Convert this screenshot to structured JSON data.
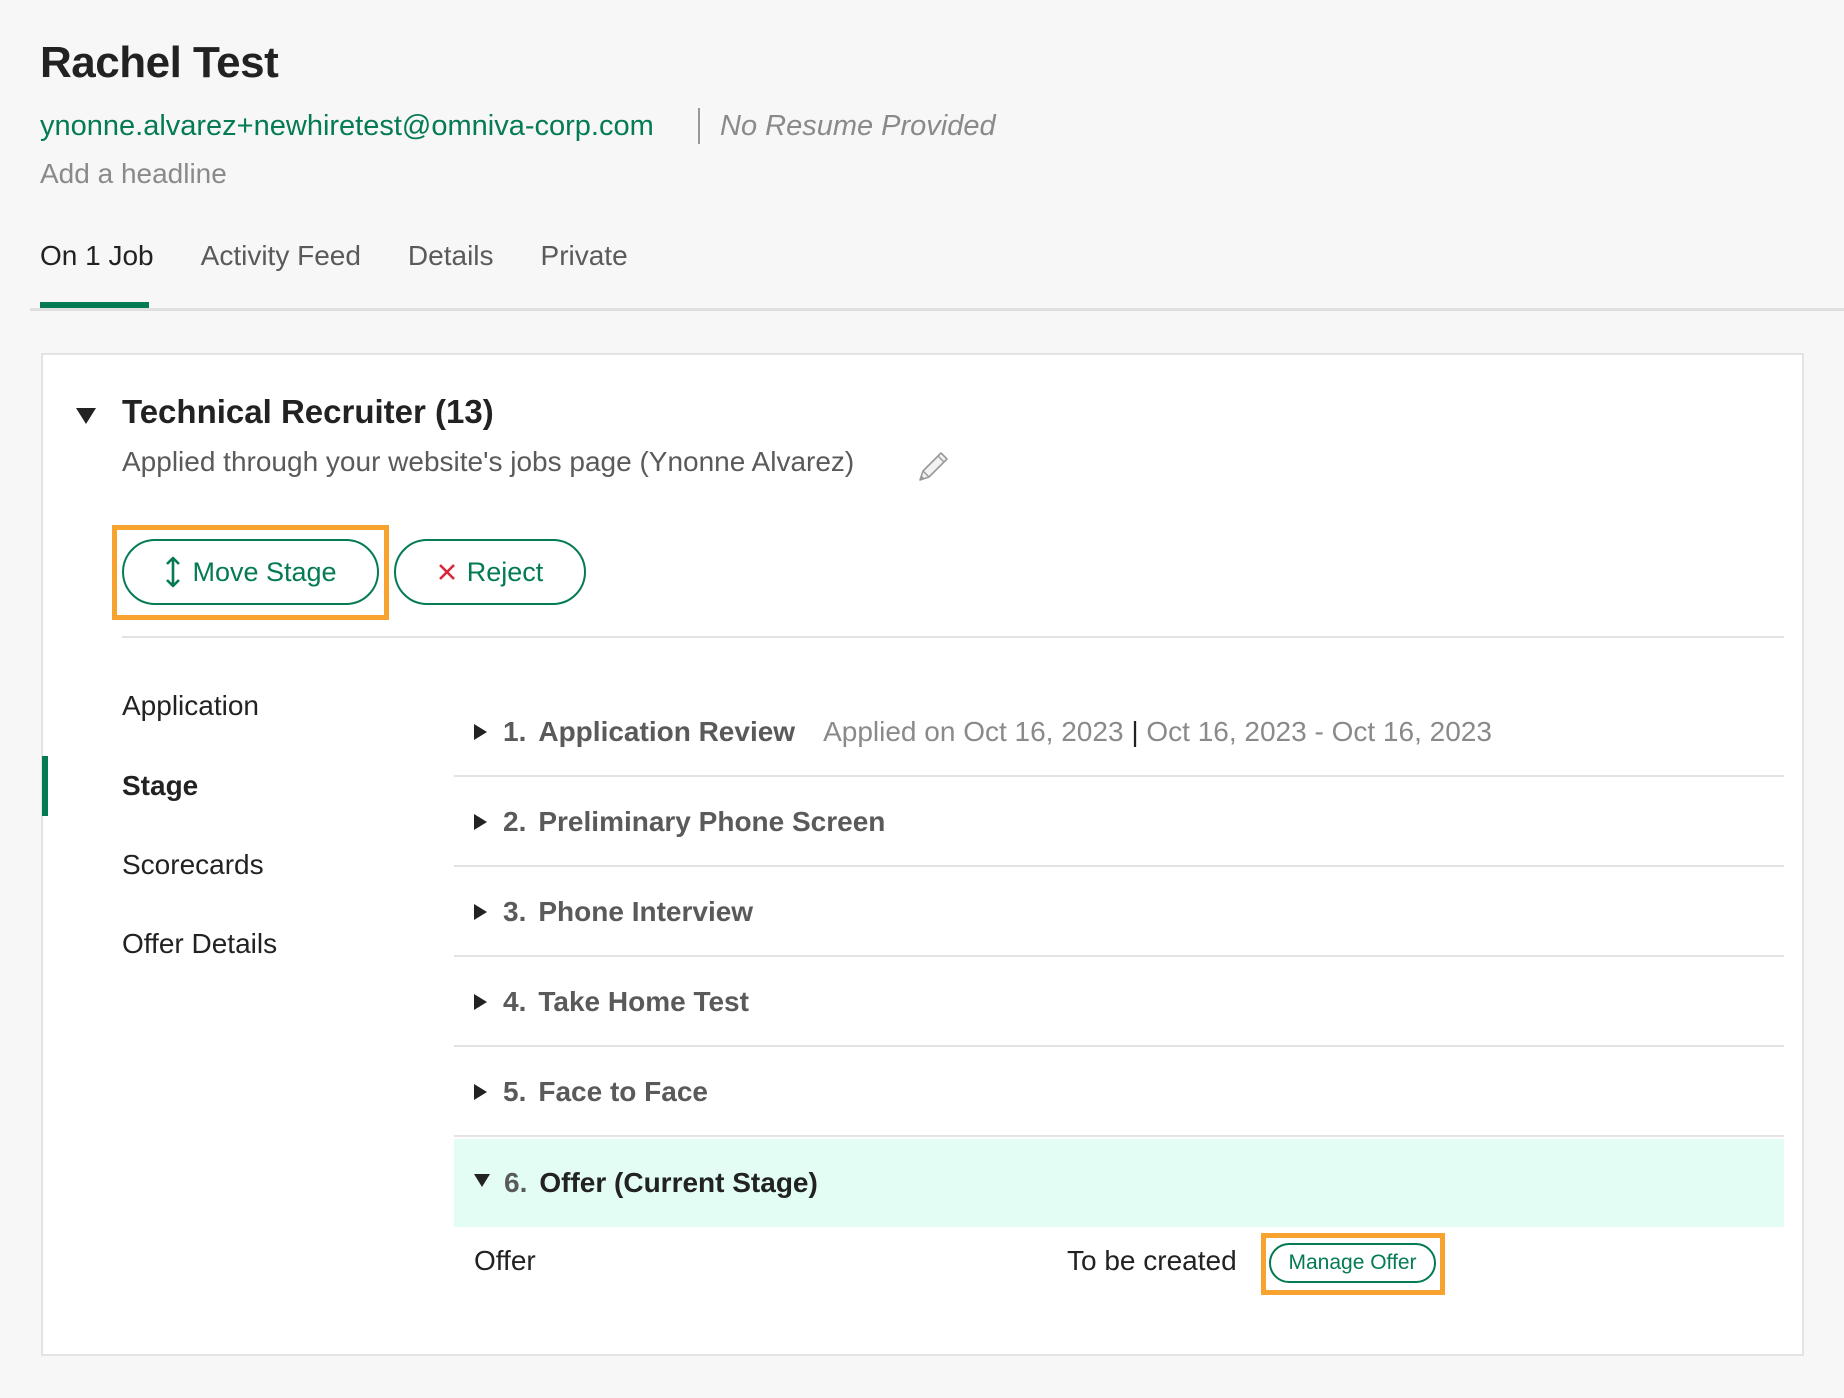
{
  "candidate": {
    "name": "Rachel Test",
    "email": "ynonne.alvarez+newhiretest@omniva-corp.com",
    "resume_status": "No Resume Provided",
    "headline_placeholder": "Add a headline"
  },
  "tabs": [
    {
      "label": "On 1 Job",
      "active": true
    },
    {
      "label": "Activity Feed",
      "active": false
    },
    {
      "label": "Details",
      "active": false
    },
    {
      "label": "Private",
      "active": false
    }
  ],
  "job": {
    "title": "Technical Recruiter (13)",
    "source": "Applied through your website's jobs page (Ynonne Alvarez)",
    "edit_icon": "pencil-icon",
    "expand_icon": "caret-down-icon"
  },
  "actions": {
    "move_stage_label": "Move Stage",
    "move_stage_icon": "vertical-arrows-icon",
    "reject_label": "Reject",
    "reject_icon": "x-icon"
  },
  "section_nav": [
    {
      "label": "Application",
      "active": false
    },
    {
      "label": "Stage",
      "active": true
    },
    {
      "label": "Scorecards",
      "active": false
    },
    {
      "label": "Offer Details",
      "active": false
    }
  ],
  "stages": [
    {
      "number": "1.",
      "name": "Application Review",
      "meta_applied": "Applied on Oct 16, 2023",
      "meta_sep": "|",
      "meta_range": "Oct 16, 2023 - Oct 16, 2023",
      "expanded": false
    },
    {
      "number": "2.",
      "name": "Preliminary Phone Screen",
      "expanded": false
    },
    {
      "number": "3.",
      "name": "Phone Interview",
      "expanded": false
    },
    {
      "number": "4.",
      "name": "Take Home Test",
      "expanded": false
    },
    {
      "number": "5.",
      "name": "Face to Face",
      "expanded": false
    },
    {
      "number": "6.",
      "name": "Offer (Current Stage)",
      "expanded": true,
      "current": true
    }
  ],
  "offer": {
    "label": "Offer",
    "status": "To be created",
    "manage_label": "Manage Offer"
  },
  "colors": {
    "brand_green": "#047a55",
    "highlight_orange": "#f8a330",
    "current_stage_bg": "#e3fdf5",
    "reject_red": "#d9283a"
  }
}
